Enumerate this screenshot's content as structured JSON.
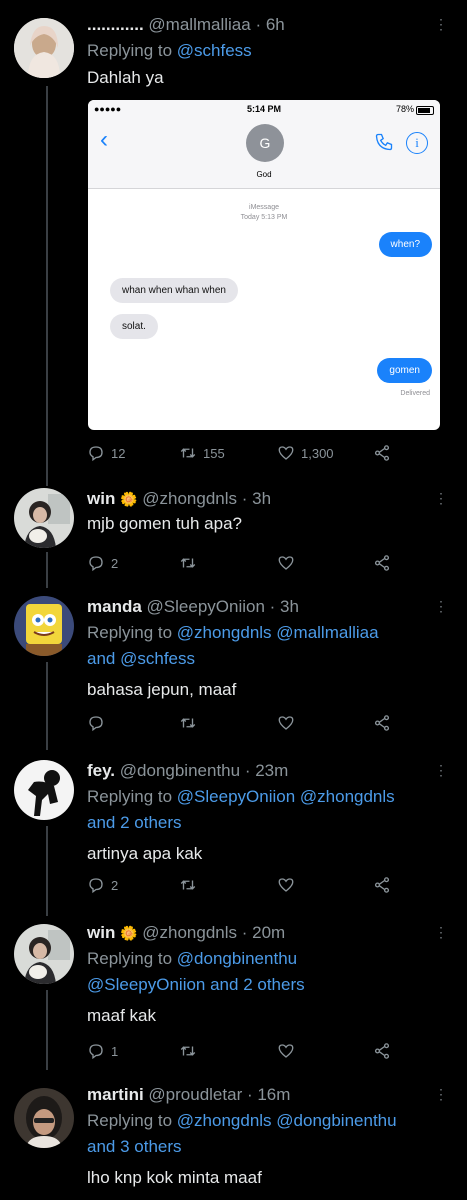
{
  "tweets": [
    {
      "name": "............",
      "handle": "@mallmalliaa",
      "time": "· 6h",
      "reply_prefix": "Replying to",
      "reply_links": "@schfess",
      "reply_tail": "",
      "text": "Dahlah ya",
      "replies": "12",
      "retweets": "155",
      "likes": "1,300"
    },
    {
      "name": "win",
      "handle": "@zhongdnls",
      "time": "· 3h",
      "text": "mjb gomen tuh apa?",
      "replies": "2",
      "retweets": "",
      "likes": ""
    },
    {
      "name": "manda",
      "handle": "@SleepyOniion",
      "time": "· 3h",
      "reply_prefix": "Replying to",
      "reply_links": "@zhongdnls @mallmalliaa",
      "reply_line2_prefix": "and",
      "reply_line2_link": "@schfess",
      "text": "bahasa jepun, maaf",
      "replies": "",
      "retweets": "",
      "likes": ""
    },
    {
      "name": "fey.",
      "handle": "@dongbinenthu",
      "time": "· 23m",
      "reply_prefix": "Replying to",
      "reply_links": "@SleepyOniion @zhongdnls",
      "reply_line2_link": "and 2 others",
      "text": "artinya apa kak",
      "replies": "2",
      "retweets": "",
      "likes": ""
    },
    {
      "name": "win",
      "handle": "@zhongdnls",
      "time": "· 20m",
      "reply_prefix": "Replying to",
      "reply_links": "@dongbinenthu",
      "reply_line2_link": "@SleepyOniion and 2 others",
      "text": "maaf kak",
      "replies": "1",
      "retweets": "",
      "likes": ""
    },
    {
      "name": "martini",
      "handle": "@proudletar",
      "time": "· 16m",
      "reply_prefix": "Replying to",
      "reply_links": "@zhongdnls @dongbinenthu",
      "reply_line2_link": "and 3 others",
      "text": "lho knp kok minta maaf"
    }
  ],
  "imessage": {
    "signal": "●●●●● ",
    "time": "5:14 PM",
    "battery": "78%",
    "contact_initial": "G",
    "contact_name": "God",
    "service": "iMessage",
    "date": "Today 5:13 PM",
    "msg1": "when?",
    "msg2": "whan when whan when",
    "msg3": "solat.",
    "msg4": "gomen",
    "status": "Delivered"
  },
  "colors": {
    "link": "#4c9be8",
    "bubble_me": "#1a82fb"
  }
}
